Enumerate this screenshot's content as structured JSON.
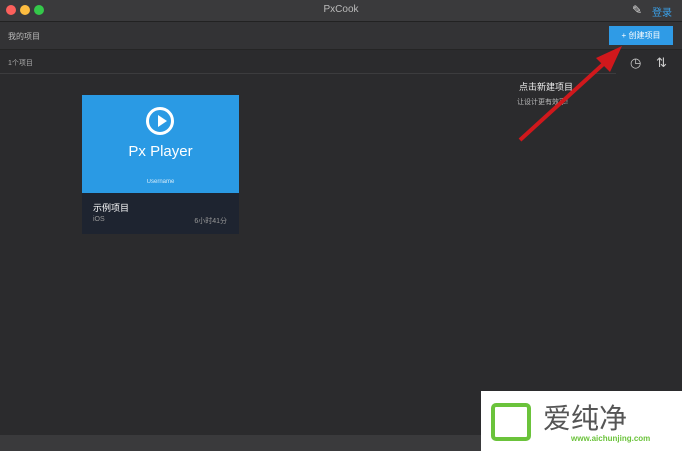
{
  "window": {
    "title": "PxCook",
    "login": "登录"
  },
  "header": {
    "my_projects": "我的项目",
    "create_button": "+ 创建项目"
  },
  "toolbar": {
    "count": "1个项目"
  },
  "tip": {
    "title": "点击新建项目",
    "subtitle": "让设计更有效率!"
  },
  "project": {
    "app_name": "Px Player",
    "username": "Username",
    "name": "示例项目",
    "platform": "iOS",
    "time": "6小时41分"
  },
  "watermark": {
    "text": "爱纯净",
    "url": "www.aichunjing.com"
  },
  "colors": {
    "accent": "#2f9be6",
    "arrow": "#d0181c"
  }
}
